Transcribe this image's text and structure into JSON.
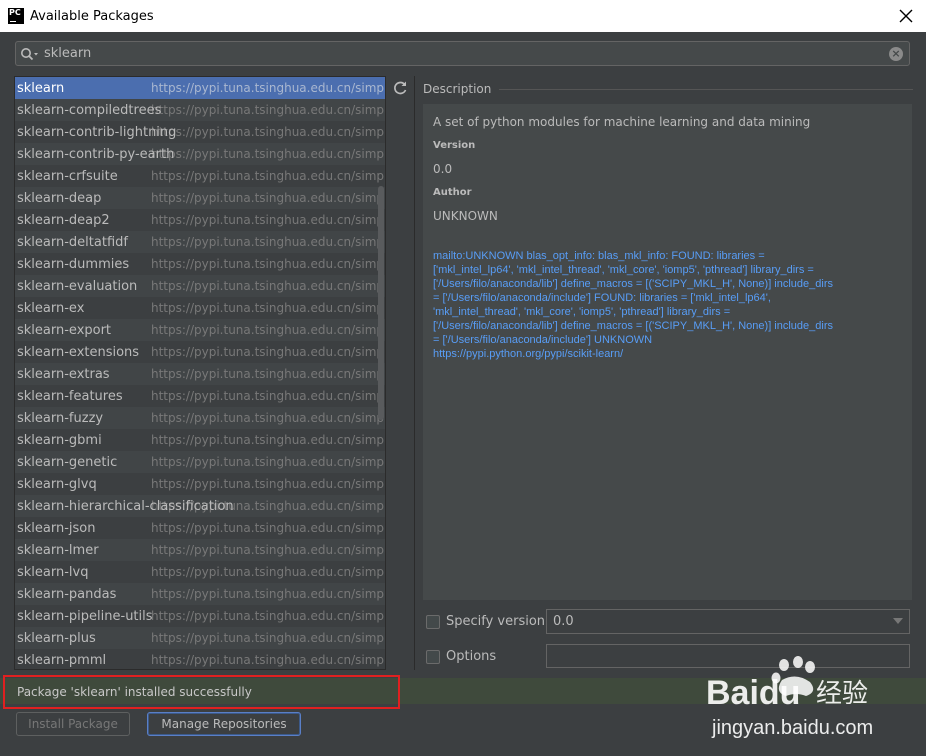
{
  "window": {
    "title": "Available Packages",
    "app_icon_text": "PC"
  },
  "search": {
    "value": "sklearn"
  },
  "packages": [
    {
      "name": "sklearn",
      "repo": "https://pypi.tuna.tsinghua.edu.cn/simple/"
    },
    {
      "name": "sklearn-compiledtrees",
      "repo": "https://pypi.tuna.tsinghua.edu.cn/simple/"
    },
    {
      "name": "sklearn-contrib-lightning",
      "repo": "https://pypi.tuna.tsinghua.edu.cn/simple/"
    },
    {
      "name": "sklearn-contrib-py-earth",
      "repo": "https://pypi.tuna.tsinghua.edu.cn/simple/"
    },
    {
      "name": "sklearn-crfsuite",
      "repo": "https://pypi.tuna.tsinghua.edu.cn/simple/"
    },
    {
      "name": "sklearn-deap",
      "repo": "https://pypi.tuna.tsinghua.edu.cn/simple/"
    },
    {
      "name": "sklearn-deap2",
      "repo": "https://pypi.tuna.tsinghua.edu.cn/simple/"
    },
    {
      "name": "sklearn-deltatfidf",
      "repo": "https://pypi.tuna.tsinghua.edu.cn/simple/"
    },
    {
      "name": "sklearn-dummies",
      "repo": "https://pypi.tuna.tsinghua.edu.cn/simple/"
    },
    {
      "name": "sklearn-evaluation",
      "repo": "https://pypi.tuna.tsinghua.edu.cn/simple/"
    },
    {
      "name": "sklearn-ex",
      "repo": "https://pypi.tuna.tsinghua.edu.cn/simple/"
    },
    {
      "name": "sklearn-export",
      "repo": "https://pypi.tuna.tsinghua.edu.cn/simple/"
    },
    {
      "name": "sklearn-extensions",
      "repo": "https://pypi.tuna.tsinghua.edu.cn/simple/"
    },
    {
      "name": "sklearn-extras",
      "repo": "https://pypi.tuna.tsinghua.edu.cn/simple/"
    },
    {
      "name": "sklearn-features",
      "repo": "https://pypi.tuna.tsinghua.edu.cn/simple/"
    },
    {
      "name": "sklearn-fuzzy",
      "repo": "https://pypi.tuna.tsinghua.edu.cn/simple/"
    },
    {
      "name": "sklearn-gbmi",
      "repo": "https://pypi.tuna.tsinghua.edu.cn/simple/"
    },
    {
      "name": "sklearn-genetic",
      "repo": "https://pypi.tuna.tsinghua.edu.cn/simple/"
    },
    {
      "name": "sklearn-glvq",
      "repo": "https://pypi.tuna.tsinghua.edu.cn/simple/"
    },
    {
      "name": "sklearn-hierarchical-classification",
      "repo": "https://pypi.tuna.tsinghua.edu.cn/simple/"
    },
    {
      "name": "sklearn-json",
      "repo": "https://pypi.tuna.tsinghua.edu.cn/simple/"
    },
    {
      "name": "sklearn-lmer",
      "repo": "https://pypi.tuna.tsinghua.edu.cn/simple/"
    },
    {
      "name": "sklearn-lvq",
      "repo": "https://pypi.tuna.tsinghua.edu.cn/simple/"
    },
    {
      "name": "sklearn-pandas",
      "repo": "https://pypi.tuna.tsinghua.edu.cn/simple/"
    },
    {
      "name": "sklearn-pipeline-utils",
      "repo": "https://pypi.tuna.tsinghua.edu.cn/simple/"
    },
    {
      "name": "sklearn-plus",
      "repo": "https://pypi.tuna.tsinghua.edu.cn/simple/"
    },
    {
      "name": "sklearn-pmml",
      "repo": "https://pypi.tuna.tsinghua.edu.cn/simple/"
    }
  ],
  "selected_index": 0,
  "description": {
    "header": "Description",
    "summary": "A set of python modules for machine learning and data mining",
    "version_label": "Version",
    "version_value": "0.0",
    "author_label": "Author",
    "author_value": "UNKNOWN",
    "links": [
      "mailto:UNKNOWN blas_opt_info: blas_mkl_info: FOUND: libraries =",
      "['mkl_intel_lp64', 'mkl_intel_thread', 'mkl_core', 'iomp5', 'pthread'] library_dirs =",
      "['/Users/filo/anaconda/lib'] define_macros = [('SCIPY_MKL_H', None)] include_dirs",
      "= ['/Users/filo/anaconda/include'] FOUND: libraries = ['mkl_intel_lp64',",
      "'mkl_intel_thread', 'mkl_core', 'iomp5', 'pthread'] library_dirs =",
      "['/Users/filo/anaconda/lib'] define_macros = [('SCIPY_MKL_H', None)] include_dirs",
      "= ['/Users/filo/anaconda/include'] UNKNOWN",
      "https://pypi.python.org/pypi/scikit-learn/"
    ]
  },
  "options": {
    "specify_version_label": "Specify version",
    "specify_version_value": "0.0",
    "options_label": "Options",
    "options_value": ""
  },
  "status": {
    "message": "Package 'sklearn' installed successfully"
  },
  "buttons": {
    "install": "Install Package",
    "manage": "Manage Repositories"
  },
  "watermark": {
    "brand": "Baidu",
    "cn": "经验",
    "url": "jingyan.baidu.com"
  },
  "colors": {
    "selection": "#4b6eaf",
    "link": "#589df6",
    "highlight_border": "#e02020"
  }
}
